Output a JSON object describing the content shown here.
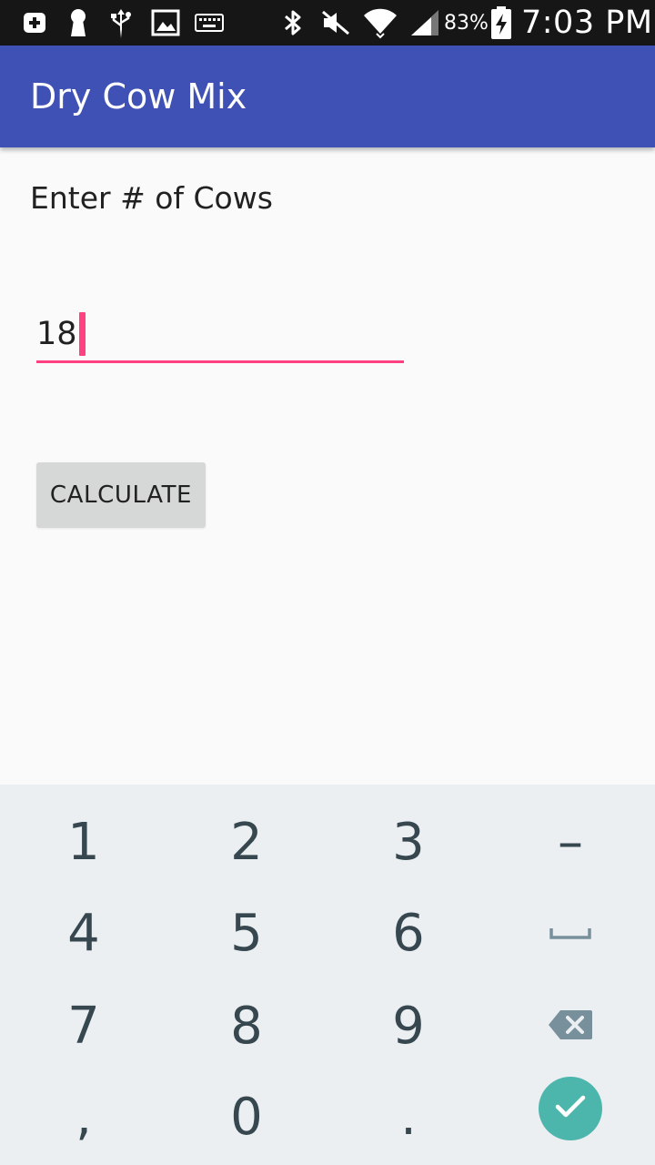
{
  "status_bar": {
    "battery_percent": "83%",
    "time": "7:03 PM",
    "icons": [
      "add-box-icon",
      "keyhole-icon",
      "usb-icon",
      "image-icon",
      "keyboard-icon",
      "bluetooth-icon",
      "mute-icon",
      "wifi-icon",
      "signal-icon",
      "battery-charging-icon"
    ]
  },
  "app_bar": {
    "title": "Dry Cow Mix",
    "color": "#3f51b5"
  },
  "form": {
    "prompt_label": "Enter # of Cows",
    "cows_value": "18",
    "accent_color": "#ff4081",
    "calculate_label": "CALCULATE"
  },
  "keyboard": {
    "keys": {
      "k1": "1",
      "k2": "2",
      "k3": "3",
      "minus": "–",
      "k4": "4",
      "k5": "5",
      "k6": "6",
      "k7": "7",
      "k8": "8",
      "k9": "9",
      "comma": ",",
      "k0": "0",
      "period": "."
    },
    "special_keys": [
      "space-icon",
      "backspace-icon",
      "done-check-icon"
    ],
    "done_color": "#4db6ac"
  }
}
